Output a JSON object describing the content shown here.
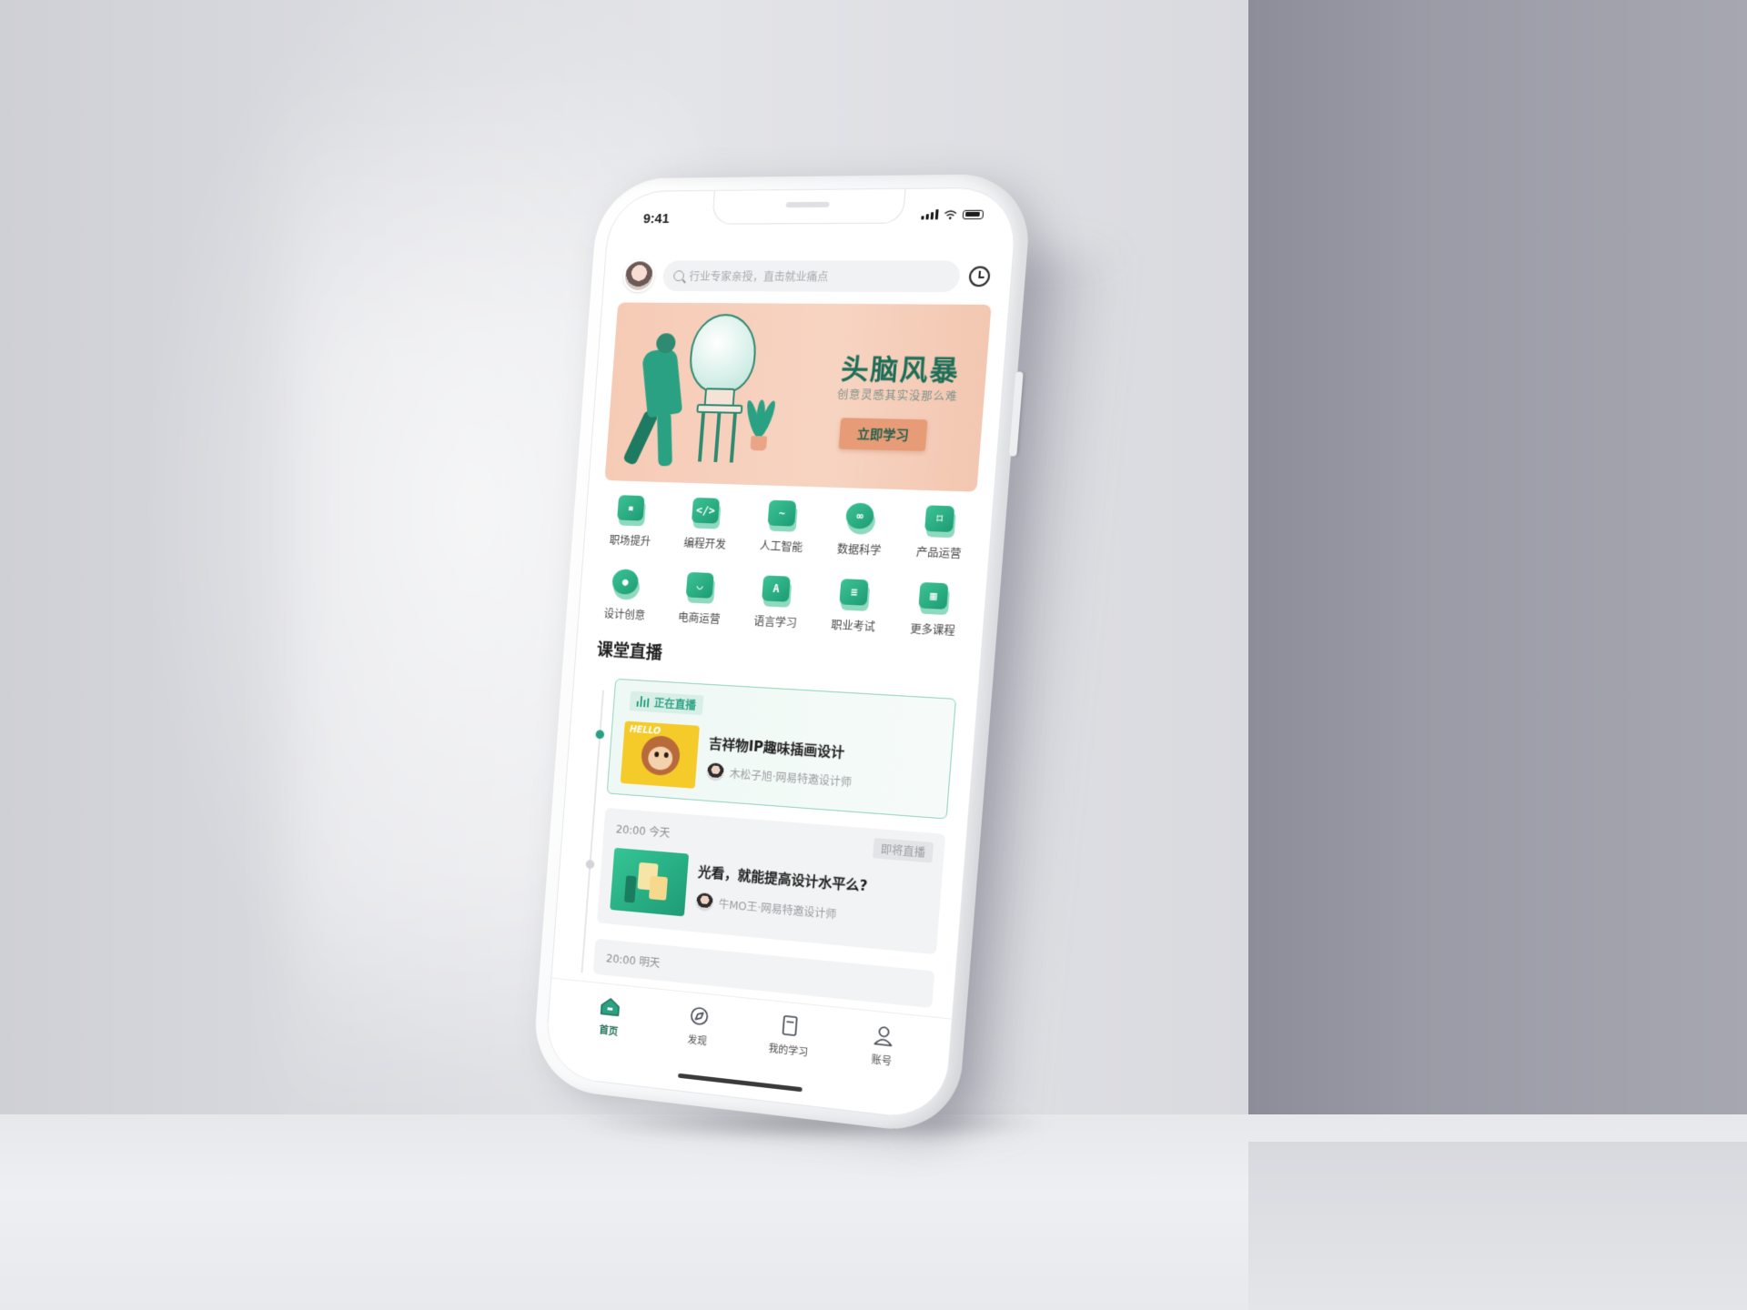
{
  "status_bar": {
    "time": "9:41"
  },
  "search": {
    "placeholder": "行业专家亲授，直击就业痛点"
  },
  "banner": {
    "title": "头脑风暴",
    "subtitle": "创意灵感其实没那么难",
    "button": "立即学习"
  },
  "categories": [
    {
      "label": "职场提升",
      "icon": "briefcase-icon"
    },
    {
      "label": "编程开发",
      "icon": "code-monitor-icon"
    },
    {
      "label": "人工智能",
      "icon": "tv-pulse-icon"
    },
    {
      "label": "数据科学",
      "icon": "cloud-icon"
    },
    {
      "label": "产品运营",
      "icon": "bookmark-icon"
    },
    {
      "label": "设计创意",
      "icon": "palette-icon"
    },
    {
      "label": "电商运营",
      "icon": "shopping-bag-icon"
    },
    {
      "label": "语言学习",
      "icon": "letter-a-icon"
    },
    {
      "label": "职业考试",
      "icon": "exam-paper-icon"
    },
    {
      "label": "更多课程",
      "icon": "grid-more-icon"
    }
  ],
  "live_section": {
    "title": "课堂直播",
    "live_card": {
      "badge": "正在直播",
      "thumb_text": "HELLO",
      "course": "吉祥物IP趣味插画设计",
      "lecturer": "木松子旭·网易特邀设计师"
    },
    "upcoming_card": {
      "time": "20:00 今天",
      "tag": "即将直播",
      "course": "光看，就能提高设计水平么?",
      "lecturer": "牛MO王·网易特邀设计师"
    },
    "next_card": {
      "time": "20:00 明天"
    }
  },
  "tabbar": [
    {
      "label": "首页",
      "icon": "home-icon",
      "active": true
    },
    {
      "label": "发现",
      "icon": "discover-icon",
      "active": false
    },
    {
      "label": "我的学习",
      "icon": "book-icon",
      "active": false
    },
    {
      "label": "账号",
      "icon": "user-icon",
      "active": false
    }
  ],
  "colors": {
    "accent": "#2aa183",
    "banner_bg": "#f7d4c2",
    "banner_button": "#e79c77",
    "title_green": "#1d6e57"
  }
}
